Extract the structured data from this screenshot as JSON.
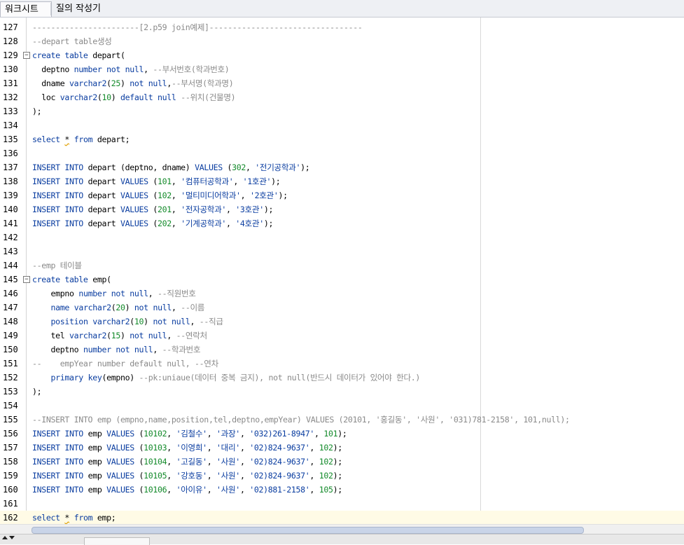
{
  "tabs": [
    {
      "label": "워크시트",
      "active": true
    },
    {
      "label": "질의 작성기",
      "active": false
    }
  ],
  "lines": [
    {
      "num": "127",
      "tokens": [
        {
          "t": "-----------------------[2.p59 join예제]---------------------------------",
          "c": "c"
        }
      ]
    },
    {
      "num": "128",
      "tokens": [
        {
          "t": "--depart table생성",
          "c": "c"
        }
      ]
    },
    {
      "num": "129",
      "fold": true,
      "tokens": [
        {
          "t": "create table",
          "c": "k"
        },
        {
          "t": " depart(",
          "c": "p"
        }
      ]
    },
    {
      "num": "130",
      "tokens": [
        {
          "t": "  deptno ",
          "c": "p"
        },
        {
          "t": "number not null",
          "c": "k"
        },
        {
          "t": ", ",
          "c": "p"
        },
        {
          "t": "--부서번호(학과번호)",
          "c": "c"
        }
      ]
    },
    {
      "num": "131",
      "tokens": [
        {
          "t": "  dname ",
          "c": "p"
        },
        {
          "t": "varchar2",
          "c": "k"
        },
        {
          "t": "(",
          "c": "p"
        },
        {
          "t": "25",
          "c": "n"
        },
        {
          "t": ") ",
          "c": "p"
        },
        {
          "t": "not null",
          "c": "k"
        },
        {
          "t": ",",
          "c": "p"
        },
        {
          "t": "--부서명(학과명)",
          "c": "c"
        }
      ]
    },
    {
      "num": "132",
      "tokens": [
        {
          "t": "  loc ",
          "c": "p"
        },
        {
          "t": "varchar2",
          "c": "k"
        },
        {
          "t": "(",
          "c": "p"
        },
        {
          "t": "10",
          "c": "n"
        },
        {
          "t": ") ",
          "c": "p"
        },
        {
          "t": "default null",
          "c": "k"
        },
        {
          "t": " ",
          "c": "p"
        },
        {
          "t": "--위치(건물명)",
          "c": "c"
        }
      ]
    },
    {
      "num": "133",
      "tokens": [
        {
          "t": ");",
          "c": "p"
        }
      ]
    },
    {
      "num": "134",
      "tokens": []
    },
    {
      "num": "135",
      "tokens": [
        {
          "t": "select",
          "c": "k"
        },
        {
          "t": " ",
          "c": "p"
        },
        {
          "t": "*",
          "c": "op"
        },
        {
          "t": " ",
          "c": "p"
        },
        {
          "t": "from",
          "c": "k"
        },
        {
          "t": " depart;",
          "c": "p"
        }
      ]
    },
    {
      "num": "136",
      "tokens": []
    },
    {
      "num": "137",
      "tokens": [
        {
          "t": "INSERT INTO",
          "c": "k"
        },
        {
          "t": " depart (deptno, dname) ",
          "c": "p"
        },
        {
          "t": "VALUES",
          "c": "k"
        },
        {
          "t": " (",
          "c": "p"
        },
        {
          "t": "302",
          "c": "n"
        },
        {
          "t": ", ",
          "c": "p"
        },
        {
          "t": "'전기공학과'",
          "c": "s"
        },
        {
          "t": ");",
          "c": "p"
        }
      ]
    },
    {
      "num": "138",
      "tokens": [
        {
          "t": "INSERT INTO",
          "c": "k"
        },
        {
          "t": " depart ",
          "c": "p"
        },
        {
          "t": "VALUES",
          "c": "k"
        },
        {
          "t": " (",
          "c": "p"
        },
        {
          "t": "101",
          "c": "n"
        },
        {
          "t": ", ",
          "c": "p"
        },
        {
          "t": "'컴퓨터공학과'",
          "c": "s"
        },
        {
          "t": ", ",
          "c": "p"
        },
        {
          "t": "'1호관'",
          "c": "s"
        },
        {
          "t": ");",
          "c": "p"
        }
      ]
    },
    {
      "num": "139",
      "tokens": [
        {
          "t": "INSERT INTO",
          "c": "k"
        },
        {
          "t": " depart ",
          "c": "p"
        },
        {
          "t": "VALUES",
          "c": "k"
        },
        {
          "t": " (",
          "c": "p"
        },
        {
          "t": "102",
          "c": "n"
        },
        {
          "t": ", ",
          "c": "p"
        },
        {
          "t": "'멀티미디어학과'",
          "c": "s"
        },
        {
          "t": ", ",
          "c": "p"
        },
        {
          "t": "'2호관'",
          "c": "s"
        },
        {
          "t": ");",
          "c": "p"
        }
      ]
    },
    {
      "num": "140",
      "tokens": [
        {
          "t": "INSERT INTO",
          "c": "k"
        },
        {
          "t": " depart ",
          "c": "p"
        },
        {
          "t": "VALUES",
          "c": "k"
        },
        {
          "t": " (",
          "c": "p"
        },
        {
          "t": "201",
          "c": "n"
        },
        {
          "t": ", ",
          "c": "p"
        },
        {
          "t": "'전자공학과'",
          "c": "s"
        },
        {
          "t": ", ",
          "c": "p"
        },
        {
          "t": "'3호관'",
          "c": "s"
        },
        {
          "t": ");",
          "c": "p"
        }
      ]
    },
    {
      "num": "141",
      "tokens": [
        {
          "t": "INSERT INTO",
          "c": "k"
        },
        {
          "t": " depart ",
          "c": "p"
        },
        {
          "t": "VALUES",
          "c": "k"
        },
        {
          "t": " (",
          "c": "p"
        },
        {
          "t": "202",
          "c": "n"
        },
        {
          "t": ", ",
          "c": "p"
        },
        {
          "t": "'기계공학과'",
          "c": "s"
        },
        {
          "t": ", ",
          "c": "p"
        },
        {
          "t": "'4호관'",
          "c": "s"
        },
        {
          "t": ");",
          "c": "p"
        }
      ]
    },
    {
      "num": "142",
      "tokens": []
    },
    {
      "num": "143",
      "tokens": []
    },
    {
      "num": "144",
      "tokens": [
        {
          "t": "--emp 테이블",
          "c": "c"
        }
      ]
    },
    {
      "num": "145",
      "fold": true,
      "tokens": [
        {
          "t": "create table",
          "c": "k"
        },
        {
          "t": " emp(",
          "c": "p"
        }
      ]
    },
    {
      "num": "146",
      "tokens": [
        {
          "t": "    empno ",
          "c": "p"
        },
        {
          "t": "number not null",
          "c": "k"
        },
        {
          "t": ", ",
          "c": "p"
        },
        {
          "t": "--직원번호",
          "c": "c"
        }
      ]
    },
    {
      "num": "147",
      "tokens": [
        {
          "t": "    ",
          "c": "p"
        },
        {
          "t": "name",
          "c": "k"
        },
        {
          "t": " ",
          "c": "p"
        },
        {
          "t": "varchar2",
          "c": "k"
        },
        {
          "t": "(",
          "c": "p"
        },
        {
          "t": "20",
          "c": "n"
        },
        {
          "t": ") ",
          "c": "p"
        },
        {
          "t": "not null",
          "c": "k"
        },
        {
          "t": ", ",
          "c": "p"
        },
        {
          "t": "--이름",
          "c": "c"
        }
      ]
    },
    {
      "num": "148",
      "tokens": [
        {
          "t": "    ",
          "c": "p"
        },
        {
          "t": "position",
          "c": "k"
        },
        {
          "t": " ",
          "c": "p"
        },
        {
          "t": "varchar2",
          "c": "k"
        },
        {
          "t": "(",
          "c": "p"
        },
        {
          "t": "10",
          "c": "n"
        },
        {
          "t": ") ",
          "c": "p"
        },
        {
          "t": "not null",
          "c": "k"
        },
        {
          "t": ", ",
          "c": "p"
        },
        {
          "t": "--직급",
          "c": "c"
        }
      ]
    },
    {
      "num": "149",
      "tokens": [
        {
          "t": "    tel ",
          "c": "p"
        },
        {
          "t": "varchar2",
          "c": "k"
        },
        {
          "t": "(",
          "c": "p"
        },
        {
          "t": "15",
          "c": "n"
        },
        {
          "t": ") ",
          "c": "p"
        },
        {
          "t": "not null",
          "c": "k"
        },
        {
          "t": ", ",
          "c": "p"
        },
        {
          "t": "--연락처",
          "c": "c"
        }
      ]
    },
    {
      "num": "150",
      "tokens": [
        {
          "t": "    deptno ",
          "c": "p"
        },
        {
          "t": "number not null",
          "c": "k"
        },
        {
          "t": ", ",
          "c": "p"
        },
        {
          "t": "--학과번호",
          "c": "c"
        }
      ]
    },
    {
      "num": "151",
      "tokens": [
        {
          "t": "--    empYear number default null, --연차",
          "c": "c"
        }
      ]
    },
    {
      "num": "152",
      "tokens": [
        {
          "t": "    ",
          "c": "p"
        },
        {
          "t": "primary key",
          "c": "k"
        },
        {
          "t": "(empno) ",
          "c": "p"
        },
        {
          "t": "--pk:uniaue(데이터 중복 금지), not null(반드시 데이터가 있어야 한다.)",
          "c": "c"
        }
      ]
    },
    {
      "num": "153",
      "tokens": [
        {
          "t": ");",
          "c": "p"
        }
      ]
    },
    {
      "num": "154",
      "tokens": []
    },
    {
      "num": "155",
      "tokens": [
        {
          "t": "--INSERT INTO emp (empno,name,position,tel,deptno,empYear) VALUES (20101, '홍길동', '사원', '031)781-2158', 101,null);",
          "c": "c"
        }
      ]
    },
    {
      "num": "156",
      "tokens": [
        {
          "t": "INSERT INTO",
          "c": "k"
        },
        {
          "t": " emp ",
          "c": "p"
        },
        {
          "t": "VALUES",
          "c": "k"
        },
        {
          "t": " (",
          "c": "p"
        },
        {
          "t": "10102",
          "c": "n"
        },
        {
          "t": ", ",
          "c": "p"
        },
        {
          "t": "'김철수'",
          "c": "s"
        },
        {
          "t": ", ",
          "c": "p"
        },
        {
          "t": "'과장'",
          "c": "s"
        },
        {
          "t": ", ",
          "c": "p"
        },
        {
          "t": "'032)261-8947'",
          "c": "s"
        },
        {
          "t": ", ",
          "c": "p"
        },
        {
          "t": "101",
          "c": "n"
        },
        {
          "t": ");",
          "c": "p"
        }
      ]
    },
    {
      "num": "157",
      "tokens": [
        {
          "t": "INSERT INTO",
          "c": "k"
        },
        {
          "t": " emp ",
          "c": "p"
        },
        {
          "t": "VALUES",
          "c": "k"
        },
        {
          "t": " (",
          "c": "p"
        },
        {
          "t": "10103",
          "c": "n"
        },
        {
          "t": ", ",
          "c": "p"
        },
        {
          "t": "'이영희'",
          "c": "s"
        },
        {
          "t": ", ",
          "c": "p"
        },
        {
          "t": "'대리'",
          "c": "s"
        },
        {
          "t": ", ",
          "c": "p"
        },
        {
          "t": "'02)824-9637'",
          "c": "s"
        },
        {
          "t": ", ",
          "c": "p"
        },
        {
          "t": "102",
          "c": "n"
        },
        {
          "t": ");",
          "c": "p"
        }
      ]
    },
    {
      "num": "158",
      "tokens": [
        {
          "t": "INSERT INTO",
          "c": "k"
        },
        {
          "t": " emp ",
          "c": "p"
        },
        {
          "t": "VALUES",
          "c": "k"
        },
        {
          "t": " (",
          "c": "p"
        },
        {
          "t": "10104",
          "c": "n"
        },
        {
          "t": ", ",
          "c": "p"
        },
        {
          "t": "'고길동'",
          "c": "s"
        },
        {
          "t": ", ",
          "c": "p"
        },
        {
          "t": "'사원'",
          "c": "s"
        },
        {
          "t": ", ",
          "c": "p"
        },
        {
          "t": "'02)824-9637'",
          "c": "s"
        },
        {
          "t": ", ",
          "c": "p"
        },
        {
          "t": "102",
          "c": "n"
        },
        {
          "t": ");",
          "c": "p"
        }
      ]
    },
    {
      "num": "159",
      "tokens": [
        {
          "t": "INSERT INTO",
          "c": "k"
        },
        {
          "t": " emp ",
          "c": "p"
        },
        {
          "t": "VALUES",
          "c": "k"
        },
        {
          "t": " (",
          "c": "p"
        },
        {
          "t": "10105",
          "c": "n"
        },
        {
          "t": ", ",
          "c": "p"
        },
        {
          "t": "'강호동'",
          "c": "s"
        },
        {
          "t": ", ",
          "c": "p"
        },
        {
          "t": "'사원'",
          "c": "s"
        },
        {
          "t": ", ",
          "c": "p"
        },
        {
          "t": "'02)824-9637'",
          "c": "s"
        },
        {
          "t": ", ",
          "c": "p"
        },
        {
          "t": "102",
          "c": "n"
        },
        {
          "t": ");",
          "c": "p"
        }
      ]
    },
    {
      "num": "160",
      "tokens": [
        {
          "t": "INSERT INTO",
          "c": "k"
        },
        {
          "t": " emp ",
          "c": "p"
        },
        {
          "t": "VALUES",
          "c": "k"
        },
        {
          "t": " (",
          "c": "p"
        },
        {
          "t": "10106",
          "c": "n"
        },
        {
          "t": ", ",
          "c": "p"
        },
        {
          "t": "'아이유'",
          "c": "s"
        },
        {
          "t": ", ",
          "c": "p"
        },
        {
          "t": "'사원'",
          "c": "s"
        },
        {
          "t": ", ",
          "c": "p"
        },
        {
          "t": "'02)881-2158'",
          "c": "s"
        },
        {
          "t": ", ",
          "c": "p"
        },
        {
          "t": "105",
          "c": "n"
        },
        {
          "t": ");",
          "c": "p"
        }
      ]
    },
    {
      "num": "161",
      "tokens": []
    },
    {
      "num": "162",
      "current": true,
      "tokens": [
        {
          "t": "select",
          "c": "k"
        },
        {
          "t": " ",
          "c": "p"
        },
        {
          "t": "*",
          "c": "op"
        },
        {
          "t": " ",
          "c": "p"
        },
        {
          "t": "from",
          "c": "k"
        },
        {
          "t": " emp;",
          "c": "p"
        }
      ]
    }
  ],
  "colors": {
    "keyword": "#0a3da0",
    "string": "#0a3da0",
    "number": "#138a2a",
    "comment": "#8a8a8a",
    "current_line": "#fffbe6"
  },
  "icons": {
    "fold_marker": "minus-box-icon",
    "arrow_up": "triangle-up-icon",
    "arrow_down": "triangle-down-icon"
  }
}
